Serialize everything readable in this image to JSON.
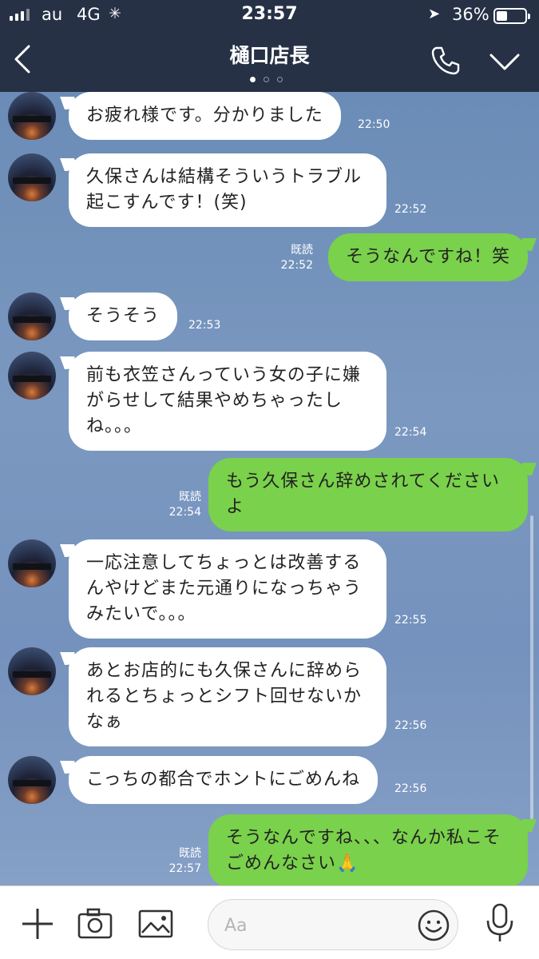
{
  "status_bar": {
    "carrier": "au",
    "network": "4G",
    "time": "23:57",
    "battery_percent": "36%",
    "battery_level": 0.36
  },
  "header": {
    "title": "樋口店長",
    "page_dots": 3,
    "active_dot": 0
  },
  "messages": [
    {
      "from": "other",
      "text": "お疲れ様です。分かりました",
      "time": "22:50"
    },
    {
      "from": "other",
      "text": "久保さんは結構そういうトラブル起こすんです！(笑)",
      "time": "22:52"
    },
    {
      "from": "me",
      "text": "そうなんですね！笑",
      "read": "既読",
      "time": "22:52"
    },
    {
      "from": "other",
      "text": "そうそう",
      "time": "22:53"
    },
    {
      "from": "other",
      "text": "前も衣笠さんっていう女の子に嫌がらせして結果やめちゃったしね。。。",
      "time": "22:54"
    },
    {
      "from": "me",
      "text": "もう久保さん辞めされてくださいよ",
      "read": "既読",
      "time": "22:54"
    },
    {
      "from": "other",
      "text": "一応注意してちょっとは改善するんやけどまた元通りになっちゃうみたいで。。。",
      "time": "22:55"
    },
    {
      "from": "other",
      "text": "あとお店的にも久保さんに辞められるとちょっとシフト回せないかなぁ",
      "time": "22:56"
    },
    {
      "from": "other",
      "text": "こっちの都合でホントにごめんね",
      "time": "22:56"
    },
    {
      "from": "me",
      "text": "そうなんですね、、、なんか私こそごめんなさい🙏",
      "read": "既読",
      "time": "22:57"
    }
  ],
  "composer": {
    "placeholder": "Aa",
    "icons": [
      "plus-icon",
      "camera-icon",
      "image-icon",
      "emoji-icon",
      "microphone-icon"
    ]
  },
  "colors": {
    "header_bg": "#263146",
    "outgoing_bubble": "#7ad14b",
    "incoming_bubble": "#ffffff"
  }
}
